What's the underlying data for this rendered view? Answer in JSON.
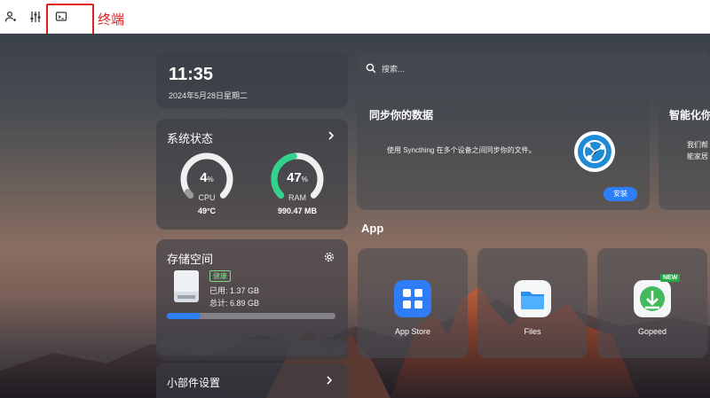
{
  "toolbar": {
    "icons": [
      "user-icon",
      "sliders-icon",
      "terminal-icon"
    ],
    "annotation": "终端",
    "annotation_color": "#e02020"
  },
  "clock": {
    "time": "11:35",
    "date": "2024年5月28日星期二"
  },
  "system_status": {
    "title": "系统状态",
    "cpu": {
      "value": "4",
      "unit": "%",
      "label": "CPU",
      "sub": "49°C",
      "percent": 4
    },
    "ram": {
      "value": "47",
      "unit": "%",
      "label": "RAM",
      "sub": "990.47 MB",
      "percent": 47
    }
  },
  "storage": {
    "title": "存储空间",
    "health": "健康",
    "used": "已用: 1.37 GB",
    "total": "总计: 6.89 GB",
    "used_fraction": 0.2
  },
  "widget_settings": {
    "label": "小部件设置"
  },
  "search": {
    "placeholder": "搜索..."
  },
  "sync_card": {
    "title": "同步你的数据",
    "description": "使用 Syncthing 在多个设备之间同步你的文件。",
    "button": "安装"
  },
  "ai_card": {
    "title": "智能化你",
    "description": "我们帮\n能家居"
  },
  "apps_section": {
    "title": "App",
    "apps": [
      {
        "name": "App Store",
        "icon": "app-store-icon"
      },
      {
        "name": "Files",
        "icon": "folder-icon"
      },
      {
        "name": "Gopeed",
        "icon": "gopeed-download-icon",
        "badge": "NEW"
      }
    ]
  },
  "colors": {
    "accent": "#2d7ff9",
    "gauge_cpu": "#9a9a9a",
    "gauge_ram": "#2fd48a",
    "health": "#7fd88a"
  }
}
